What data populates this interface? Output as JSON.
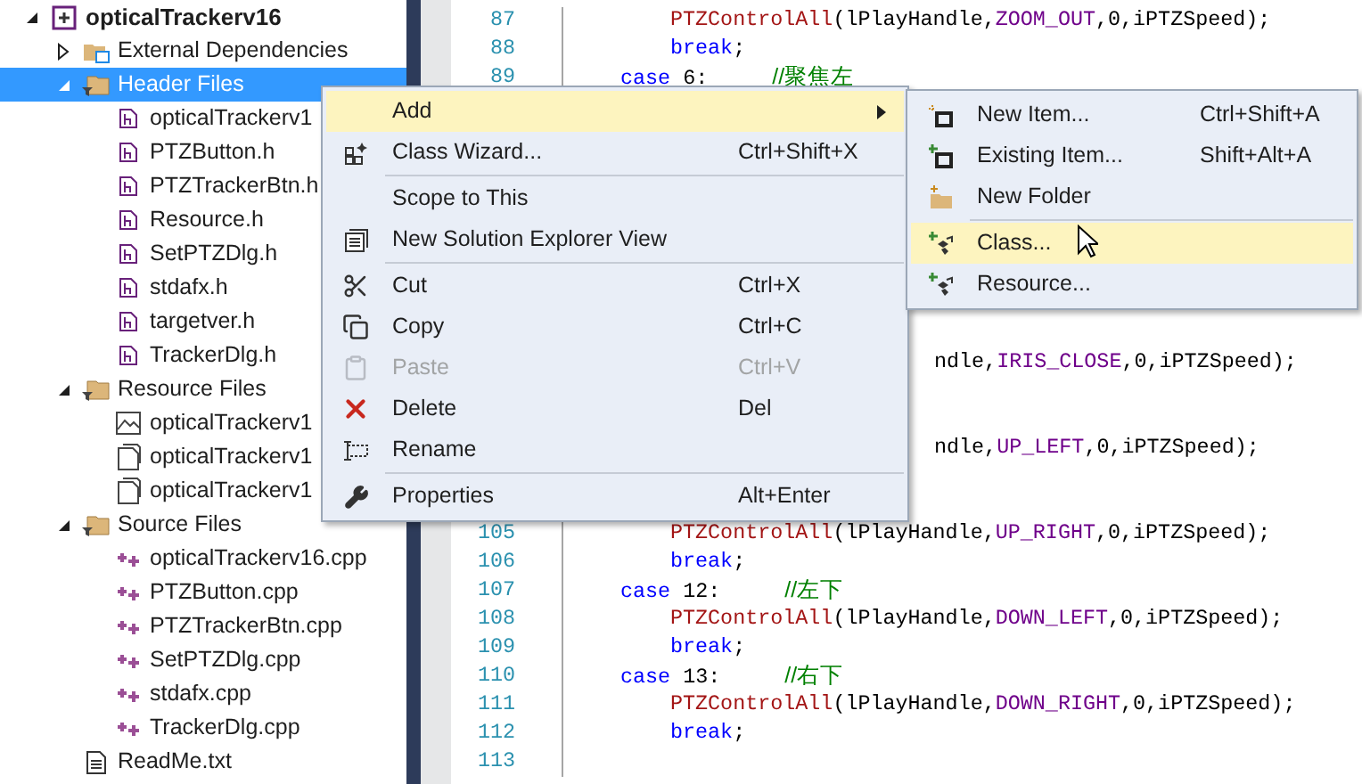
{
  "solution_explorer": {
    "tree": [
      {
        "label": "opticalTrackerv16",
        "kind": "project",
        "expanded": true,
        "selected": false,
        "children": [
          {
            "label": "External Dependencies",
            "kind": "external",
            "expanded": false,
            "selected": false
          },
          {
            "label": "Header Files",
            "kind": "filter",
            "expanded": true,
            "selected": true,
            "children": [
              {
                "label": "opticalTrackerv1",
                "kind": "header",
                "selected": false
              },
              {
                "label": "PTZButton.h",
                "kind": "header",
                "selected": false
              },
              {
                "label": "PTZTrackerBtn.h",
                "kind": "header",
                "selected": false
              },
              {
                "label": "Resource.h",
                "kind": "header",
                "selected": false
              },
              {
                "label": "SetPTZDlg.h",
                "kind": "header",
                "selected": false
              },
              {
                "label": "stdafx.h",
                "kind": "header",
                "selected": false
              },
              {
                "label": "targetver.h",
                "kind": "header",
                "selected": false
              },
              {
                "label": "TrackerDlg.h",
                "kind": "header",
                "selected": false
              }
            ]
          },
          {
            "label": "Resource Files",
            "kind": "filter",
            "expanded": true,
            "selected": false,
            "children": [
              {
                "label": "opticalTrackerv1",
                "kind": "image",
                "selected": false
              },
              {
                "label": "opticalTrackerv1",
                "kind": "resource",
                "selected": false
              },
              {
                "label": "opticalTrackerv1",
                "kind": "resource",
                "selected": false
              }
            ]
          },
          {
            "label": "Source Files",
            "kind": "filter",
            "expanded": true,
            "selected": false,
            "children": [
              {
                "label": "opticalTrackerv16.cpp",
                "kind": "cpp",
                "selected": false
              },
              {
                "label": "PTZButton.cpp",
                "kind": "cpp",
                "selected": false
              },
              {
                "label": "PTZTrackerBtn.cpp",
                "kind": "cpp",
                "selected": false
              },
              {
                "label": "SetPTZDlg.cpp",
                "kind": "cpp",
                "selected": false
              },
              {
                "label": "stdafx.cpp",
                "kind": "cpp",
                "selected": false
              },
              {
                "label": "TrackerDlg.cpp",
                "kind": "cpp",
                "selected": false
              }
            ]
          },
          {
            "label": "ReadMe.txt",
            "kind": "text",
            "selected": false
          }
        ]
      }
    ]
  },
  "editor": {
    "lines": [
      {
        "kind": "body",
        "number": "87",
        "segments": [
          {
            "kind": "func",
            "text": "PTZControlAll"
          },
          {
            "kind": "plain",
            "text": "(lPlayHandle,"
          },
          {
            "kind": "macro",
            "text": "ZOOM_OUT"
          },
          {
            "kind": "plain",
            "text": ",0,iPTZSpeed);"
          }
        ]
      },
      {
        "kind": "body",
        "number": "88",
        "segments": [
          {
            "kind": "keyword",
            "text": "break"
          },
          {
            "kind": "plain",
            "text": ";"
          }
        ]
      },
      {
        "kind": "case",
        "number": "89",
        "segments": [
          {
            "kind": "keyword",
            "text": "case"
          },
          {
            "kind": "plain",
            "text": " 6:"
          },
          {
            "kind": "comment",
            "text": "//聚焦左"
          }
        ]
      },
      {
        "kind": "covered"
      },
      {
        "kind": "covered"
      },
      {
        "kind": "covered"
      },
      {
        "kind": "covered"
      },
      {
        "kind": "covered"
      },
      {
        "kind": "covered"
      },
      {
        "kind": "covered"
      },
      {
        "kind": "covered"
      },
      {
        "kind": "covered"
      },
      {
        "kind": "fragment",
        "segments": [
          {
            "kind": "plain",
            "text": "ndle,"
          },
          {
            "kind": "macro",
            "text": "IRIS_CLOSE"
          },
          {
            "kind": "plain",
            "text": ",0,iPTZSpeed);"
          }
        ]
      },
      {
        "kind": "covered"
      },
      {
        "kind": "covered"
      },
      {
        "kind": "fragment",
        "segments": [
          {
            "kind": "plain",
            "text": "ndle,"
          },
          {
            "kind": "macro",
            "text": "UP_LEFT"
          },
          {
            "kind": "plain",
            "text": ",0,iPTZSpeed);"
          }
        ]
      },
      {
        "kind": "covered"
      },
      {
        "kind": "covered"
      },
      {
        "kind": "body",
        "number": "105",
        "segments": [
          {
            "kind": "func",
            "text": "PTZControlAll"
          },
          {
            "kind": "plain",
            "text": "(lPlayHandle,"
          },
          {
            "kind": "macro",
            "text": "UP_RIGHT"
          },
          {
            "kind": "plain",
            "text": ",0,iPTZSpeed);"
          }
        ]
      },
      {
        "kind": "body",
        "number": "106",
        "segments": [
          {
            "kind": "keyword",
            "text": "break"
          },
          {
            "kind": "plain",
            "text": ";"
          }
        ]
      },
      {
        "kind": "case",
        "number": "107",
        "segments": [
          {
            "kind": "keyword",
            "text": "case"
          },
          {
            "kind": "plain",
            "text": " 12:"
          },
          {
            "kind": "comment",
            "text": "//左下"
          }
        ]
      },
      {
        "kind": "body",
        "number": "108",
        "segments": [
          {
            "kind": "func",
            "text": "PTZControlAll"
          },
          {
            "kind": "plain",
            "text": "(lPlayHandle,"
          },
          {
            "kind": "macro",
            "text": "DOWN_LEFT"
          },
          {
            "kind": "plain",
            "text": ",0,iPTZSpeed);"
          }
        ]
      },
      {
        "kind": "body",
        "number": "109",
        "segments": [
          {
            "kind": "keyword",
            "text": "break"
          },
          {
            "kind": "plain",
            "text": ";"
          }
        ]
      },
      {
        "kind": "case",
        "number": "110",
        "segments": [
          {
            "kind": "keyword",
            "text": "case"
          },
          {
            "kind": "plain",
            "text": " 13:"
          },
          {
            "kind": "comment",
            "text": "//右下"
          }
        ]
      },
      {
        "kind": "body",
        "number": "111",
        "segments": [
          {
            "kind": "func",
            "text": "PTZControlAll"
          },
          {
            "kind": "plain",
            "text": "(lPlayHandle,"
          },
          {
            "kind": "macro",
            "text": "DOWN_RIGHT"
          },
          {
            "kind": "plain",
            "text": ",0,iPTZSpeed);"
          }
        ]
      },
      {
        "kind": "body",
        "number": "112",
        "segments": [
          {
            "kind": "keyword",
            "text": "break"
          },
          {
            "kind": "plain",
            "text": ";"
          }
        ]
      },
      {
        "kind": "blank",
        "number": "113"
      }
    ]
  },
  "context_menu": {
    "items": [
      {
        "kind": "plain",
        "label": "Add",
        "disabled": false,
        "selected": true,
        "submenu": true
      },
      {
        "kind": "wizard",
        "label": "Class Wizard...",
        "shortcut": "Ctrl+Shift+X",
        "disabled": false,
        "selected": false,
        "submenu": false
      },
      {
        "kind": "separator"
      },
      {
        "kind": "plain",
        "label": "Scope to This",
        "disabled": false,
        "selected": false,
        "submenu": false
      },
      {
        "kind": "view",
        "label": "New Solution Explorer View",
        "disabled": false,
        "selected": false,
        "submenu": false
      },
      {
        "kind": "separator"
      },
      {
        "kind": "cut",
        "label": "Cut",
        "shortcut": "Ctrl+X",
        "disabled": false,
        "selected": false,
        "submenu": false
      },
      {
        "kind": "copy",
        "label": "Copy",
        "shortcut": "Ctrl+C",
        "disabled": false,
        "selected": false,
        "submenu": false
      },
      {
        "kind": "paste",
        "label": "Paste",
        "shortcut": "Ctrl+V",
        "disabled": true,
        "selected": false,
        "submenu": false
      },
      {
        "kind": "delete",
        "label": "Delete",
        "shortcut": "Del",
        "disabled": false,
        "selected": false,
        "submenu": false
      },
      {
        "kind": "rename",
        "label": "Rename",
        "disabled": false,
        "selected": false,
        "submenu": false
      },
      {
        "kind": "separator"
      },
      {
        "kind": "wrench",
        "label": "Properties",
        "shortcut": "Alt+Enter",
        "disabled": false,
        "selected": false,
        "submenu": false
      }
    ]
  },
  "submenu": {
    "items": [
      {
        "kind": "new-item",
        "label": "New Item...",
        "shortcut": "Ctrl+Shift+A",
        "disabled": false,
        "selected": false,
        "submenu": false
      },
      {
        "kind": "existing-item",
        "label": "Existing Item...",
        "shortcut": "Shift+Alt+A",
        "disabled": false,
        "selected": false,
        "submenu": false
      },
      {
        "kind": "folder",
        "label": "New Folder",
        "disabled": false,
        "selected": false,
        "submenu": false
      },
      {
        "kind": "separator"
      },
      {
        "kind": "class",
        "label": "Class...",
        "disabled": false,
        "selected": true,
        "submenu": false
      },
      {
        "kind": "class",
        "label": "Resource...",
        "disabled": false,
        "selected": false,
        "submenu": false
      }
    ]
  }
}
